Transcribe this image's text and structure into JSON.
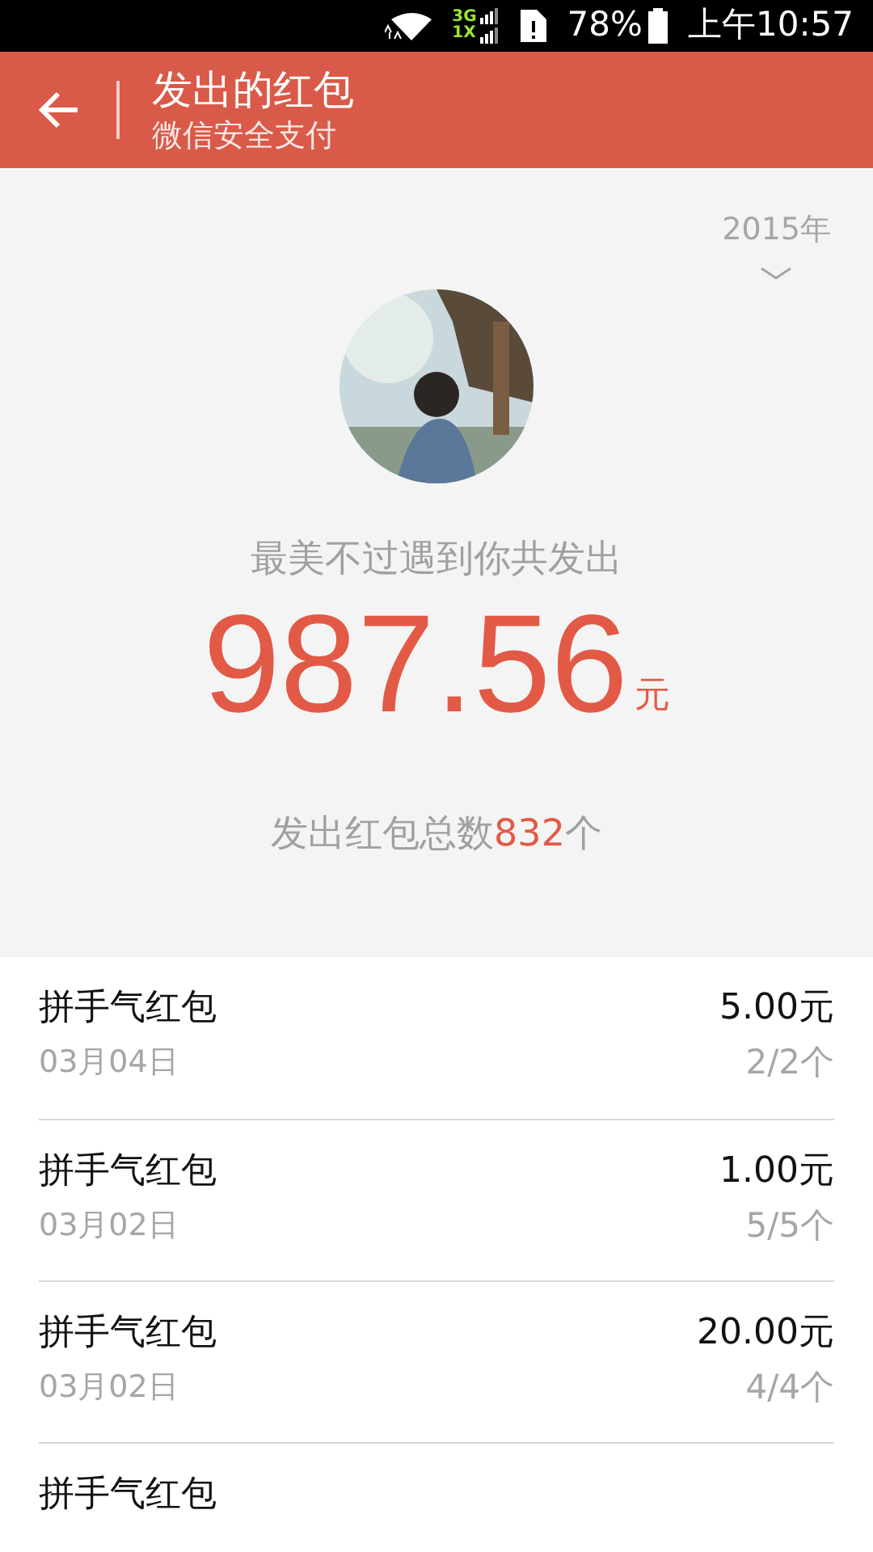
{
  "status_bar": {
    "battery": "78%",
    "time": "上午10:57",
    "network_top": "3G",
    "network_bottom": "1X"
  },
  "header": {
    "title": "发出的红包",
    "subtitle": "微信安全支付"
  },
  "summary": {
    "year": "2015年",
    "caption": "最美不过遇到你共发出",
    "amount": "987.56",
    "unit": "元",
    "count_label": "发出红包总数",
    "count": "832",
    "count_unit": "个"
  },
  "records": [
    {
      "title": "拼手气红包",
      "date": "03月04日",
      "amount": "5.00元",
      "count": "2/2个"
    },
    {
      "title": "拼手气红包",
      "date": "03月02日",
      "amount": "1.00元",
      "count": "5/5个"
    },
    {
      "title": "拼手气红包",
      "date": "03月02日",
      "amount": "20.00元",
      "count": "4/4个"
    },
    {
      "title": "拼手气红包"
    }
  ]
}
